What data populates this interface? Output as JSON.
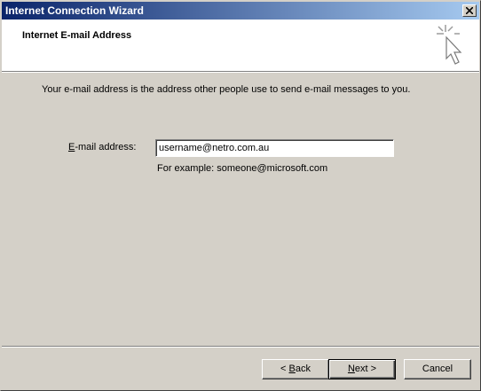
{
  "window": {
    "title": "Internet Connection Wizard"
  },
  "header": {
    "title": "Internet E-mail Address",
    "icon": "wizard-wand-cursor-icon"
  },
  "main": {
    "intro": "Your e-mail address is the address other people use to send e-mail messages to you.",
    "email_label_mnemonic": "E",
    "email_label_rest": "-mail address:",
    "email_value": "username@netro.com.au",
    "example": "For example: someone@microsoft.com"
  },
  "footer": {
    "back_prefix": "< ",
    "back_mnemonic": "B",
    "back_rest": "ack",
    "next_mnemonic": "N",
    "next_rest": "ext >",
    "cancel_label": "Cancel"
  }
}
